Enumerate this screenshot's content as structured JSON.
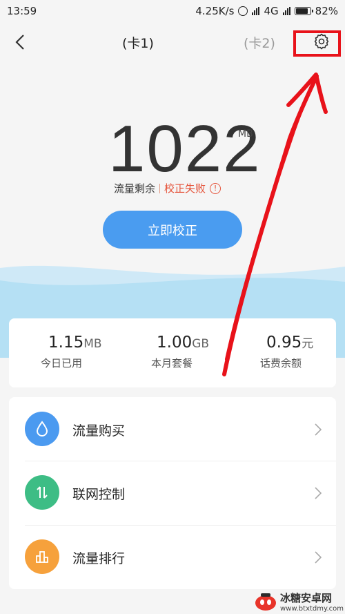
{
  "status_bar": {
    "time": "13:59",
    "speed": "4.25K/s",
    "network": "4G",
    "battery": "82%"
  },
  "header": {
    "tab_card1": "(卡1)",
    "tab_card2": "(卡2)"
  },
  "data": {
    "value": "1022",
    "unit": "MB",
    "remain_label": "流量剩余",
    "status_label": "校正失败",
    "warn_mark": "!"
  },
  "calibrate_button": "立即校正",
  "stats": [
    {
      "value": "1.15",
      "unit": "MB",
      "label": "今日已用"
    },
    {
      "value": "1.00",
      "unit": "GB",
      "label": "本月套餐"
    },
    {
      "value": "0.95",
      "unit": "元",
      "label": "话费余额"
    }
  ],
  "menu": [
    {
      "label": "流量购买",
      "icon": "droplet-icon",
      "color": "#4b9af0"
    },
    {
      "label": "联网控制",
      "icon": "up-down-arrows-icon",
      "color": "#3dbd85"
    },
    {
      "label": "流量排行",
      "icon": "bar-chart-icon",
      "color": "#f6a13c"
    }
  ],
  "colors": {
    "accent": "#4a9cf0",
    "error": "#e5533a",
    "annotation": "#e8121a"
  },
  "watermark": {
    "title": "冰糖安卓网",
    "url": "www.btxtdmy.com"
  }
}
